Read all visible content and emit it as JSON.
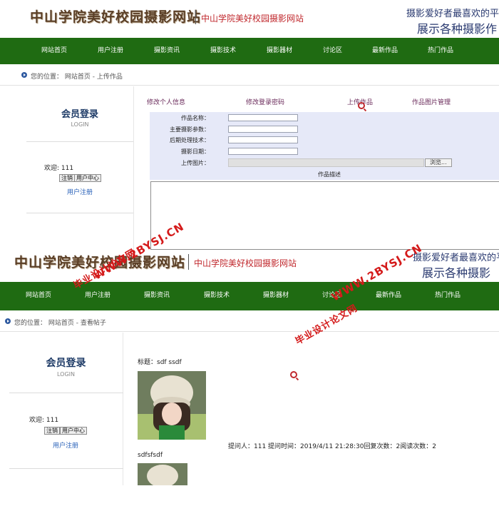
{
  "upload_page": {
    "header": {
      "site_title": "中山学院美好校园摄影网站",
      "site_subtitle": "中山学院美好校园摄影网站",
      "slogan_line1": "摄影爱好者最喜欢的平",
      "slogan_line2": "展示各种摄影作"
    },
    "nav": [
      "网站首页",
      "用户注册",
      "摄影资讯",
      "摄影技术",
      "摄影器材",
      "讨论区",
      "最新作品",
      "热门作品"
    ],
    "breadcrumb": "您的位置： 网站首页 - 上传作品",
    "sidebar": {
      "login_title": "会员登录",
      "login_sub": "LOGIN",
      "welcome": "欢迎: 111",
      "logout_button": "注销",
      "user_center_button": "用户中心",
      "register_link": "用户注册"
    },
    "subnav": [
      "修改个人信息",
      "修改登录密码",
      "上传作品",
      "作品图片管理"
    ],
    "form": {
      "fields": [
        {
          "label": "作品名称：",
          "value": ""
        },
        {
          "label": "主要摄影参数：",
          "value": ""
        },
        {
          "label": "后期处理技术：",
          "value": ""
        },
        {
          "label": "摄影日期：",
          "value": ""
        }
      ],
      "upload_label": "上传图片：",
      "browse_button": "浏览...",
      "desc_label": "作品描述"
    }
  },
  "post_page": {
    "header": {
      "site_title": "中山学院美好校园摄影网站",
      "site_subtitle": "中山学院美好校园摄影网站",
      "slogan_line1": "摄影爱好者最喜欢的平",
      "slogan_line2": "展示各种摄影"
    },
    "nav": [
      "网站首页",
      "用户注册",
      "摄影资讯",
      "摄影技术",
      "摄影器材",
      "讨论区",
      "最新作品",
      "热门作品"
    ],
    "breadcrumb": "您的位置： 网站首页 - 查看帖子",
    "sidebar": {
      "login_title": "会员登录",
      "login_sub": "LOGIN",
      "welcome": "欢迎: 111",
      "logout_button": "注销",
      "user_center_button": "用户中心",
      "register_link": "用户注册"
    },
    "post": {
      "title": "标题：sdf ssdf",
      "meta": "提问人：111 提问时间：2019/4/11 21:28:30回复次数：2阅读次数：2",
      "body": "sdfsfsdf"
    }
  },
  "watermarks": [
    "WWW.2BYSJ.CN",
    "毕业设计论文网",
    "WWW.2BYSJ.CN",
    "毕业设计论文网"
  ],
  "colors": {
    "nav_green": "#1f6b12",
    "form_panel": "#e6e9f8",
    "watermark_red": "#d41a1a"
  }
}
